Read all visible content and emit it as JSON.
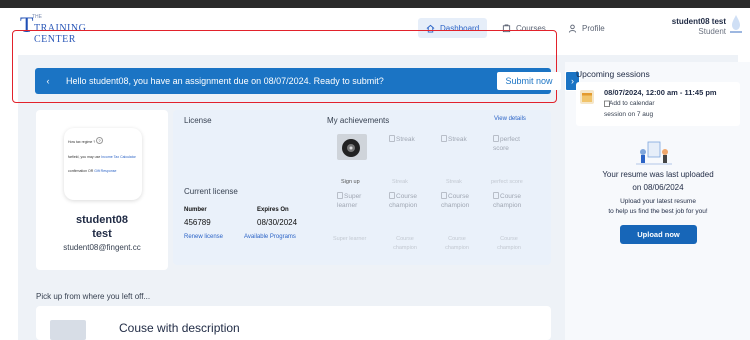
{
  "header": {
    "logo": {
      "the": "THE",
      "line1": "TRAINING",
      "line2": "CENTER"
    },
    "nav": [
      {
        "label": "Dashboard",
        "icon": "home-icon",
        "active": true
      },
      {
        "label": "Courses",
        "icon": "book-icon",
        "active": false
      },
      {
        "label": "Profile",
        "icon": "user-icon",
        "active": false
      }
    ],
    "user": {
      "name": "student08 test",
      "role": "Student"
    }
  },
  "banner": {
    "message": "Hello student08, you have an assignment due on 08/07/2024. Ready to submit?",
    "submit_label": "Submit now",
    "prev_icon": "chevron-left-icon",
    "next_icon": "chevron-right-icon"
  },
  "profile": {
    "thumb": {
      "line1": "How tax regime ?",
      "line2_prefix": "farfield, you may use ",
      "line2_link": "Income Tax Calculator",
      "line3_prefix": "confirmation OR ",
      "line3_link": "Gift Response"
    },
    "first_name": "student08",
    "last_name": "test",
    "email": "student08@fingent.cc"
  },
  "license": {
    "title": "License",
    "current_label": "Current license",
    "number_label": "Number",
    "number_value": "456789",
    "expires_label": "Expires On",
    "expires_value": "08/30/2024",
    "renew_link": "Renew license",
    "programs_link": "Available Programs"
  },
  "achievements": {
    "title": "My achievements",
    "view_details": "View details",
    "row1": [
      "Streak",
      "Streak",
      "perfect score"
    ],
    "row1_labels": [
      "Sign up",
      "Streak",
      "Streak",
      "perfect score"
    ],
    "row2": [
      "Super learner",
      "Course champion",
      "Course champion",
      "Course champion"
    ],
    "row2_labels": [
      "Super learner",
      "Course champion",
      "Course champion",
      "Course champion"
    ]
  },
  "pickup": {
    "title": "Pick up from where you left off...",
    "course_title": "Couse with description"
  },
  "sessions": {
    "title": "Upcoming sessions",
    "date": "08/07/2024, 12:00 am - 11:45 pm",
    "add_calendar": "Add to calendar",
    "note": "session on 7 aug"
  },
  "resume": {
    "line1": "Your resume was last uploaded",
    "line2": "on 08/06/2024",
    "line3": "Upload your latest resume",
    "line4": "to help us find the best job for you!",
    "button": "Upload now"
  },
  "colors": {
    "accent": "#1b74c4",
    "alert_outline": "#e2222b",
    "link": "#2b63c6",
    "panel": "#eef2f7"
  }
}
